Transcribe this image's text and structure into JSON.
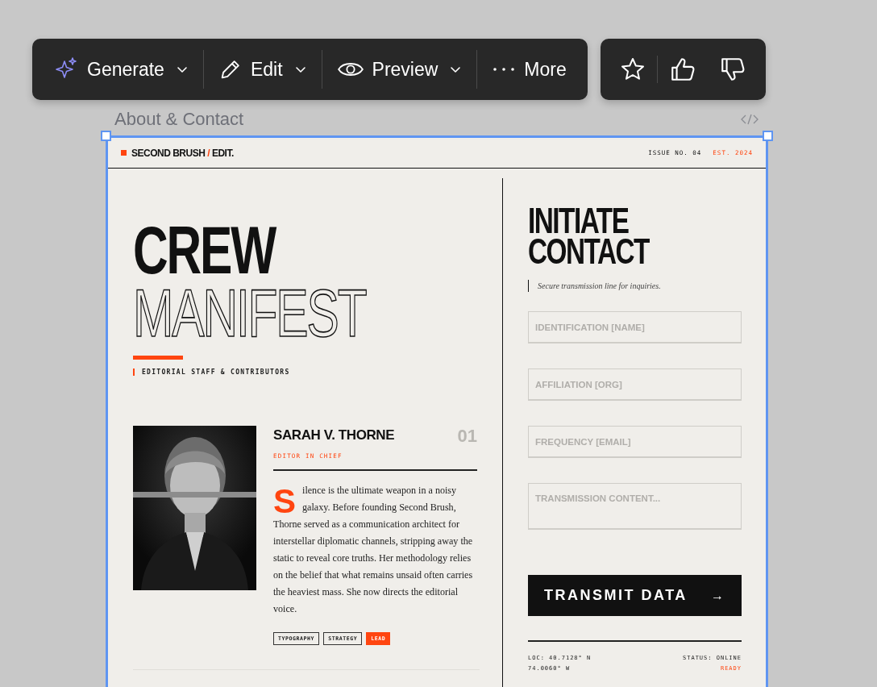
{
  "toolbar": {
    "items": [
      {
        "label": "Generate",
        "kind": "sparkle",
        "dropdown": true
      },
      {
        "label": "Edit",
        "kind": "pencil",
        "dropdown": true
      },
      {
        "label": "Preview",
        "kind": "eye",
        "dropdown": true
      },
      {
        "label": "More",
        "kind": "dots",
        "dropdown": false
      }
    ]
  },
  "section_label": "About & Contact",
  "masthead": {
    "brand": "SECOND BRUSH",
    "brand_slash": "/",
    "brand_suffix": "EDIT.",
    "issue": "ISSUE NO. 04",
    "established": "EST. 2024"
  },
  "crew": {
    "title_solid": "CREW",
    "title_outline": "MANIFEST",
    "subtitle": "EDITORIAL STAFF & CONTRIBUTORS",
    "members": [
      {
        "name": "SARAH V. THORNE",
        "index": "01",
        "role": "EDITOR IN CHIEF",
        "bio": "Silence is the ultimate weapon in a noisy galaxy. Before founding Second Brush, Thorne served as a communication architect for interstellar diplomatic channels, stripping away the static to reveal core truths. Her methodology relies on the belief that what remains unsaid often carries the heaviest mass. She now directs the editorial voice.",
        "tags": [
          {
            "label": "TYPOGRAPHY",
            "highlighted": false
          },
          {
            "label": "STRATEGY",
            "highlighted": false
          },
          {
            "label": "LEAD",
            "highlighted": true
          }
        ]
      }
    ]
  },
  "contact": {
    "title_lines": [
      "INITIATE",
      "CONTACT"
    ],
    "tagline": "Secure transmission line for inquiries.",
    "fields": [
      {
        "placeholder": "IDENTIFICATION [NAME]",
        "kind": "line"
      },
      {
        "placeholder": "AFFILIATION [ORG]",
        "kind": "line"
      },
      {
        "placeholder": "FREQUENCY [EMAIL]",
        "kind": "line"
      },
      {
        "placeholder": "TRANSMISSION CONTENT...",
        "kind": "area"
      }
    ],
    "submit": {
      "label": "TRANSMIT DATA",
      "arrow": "→"
    },
    "footer": {
      "location": [
        "LOC: 40.7128° N",
        "74.0060° W"
      ],
      "status": "STATUS: ONLINE",
      "state": "READY"
    }
  }
}
